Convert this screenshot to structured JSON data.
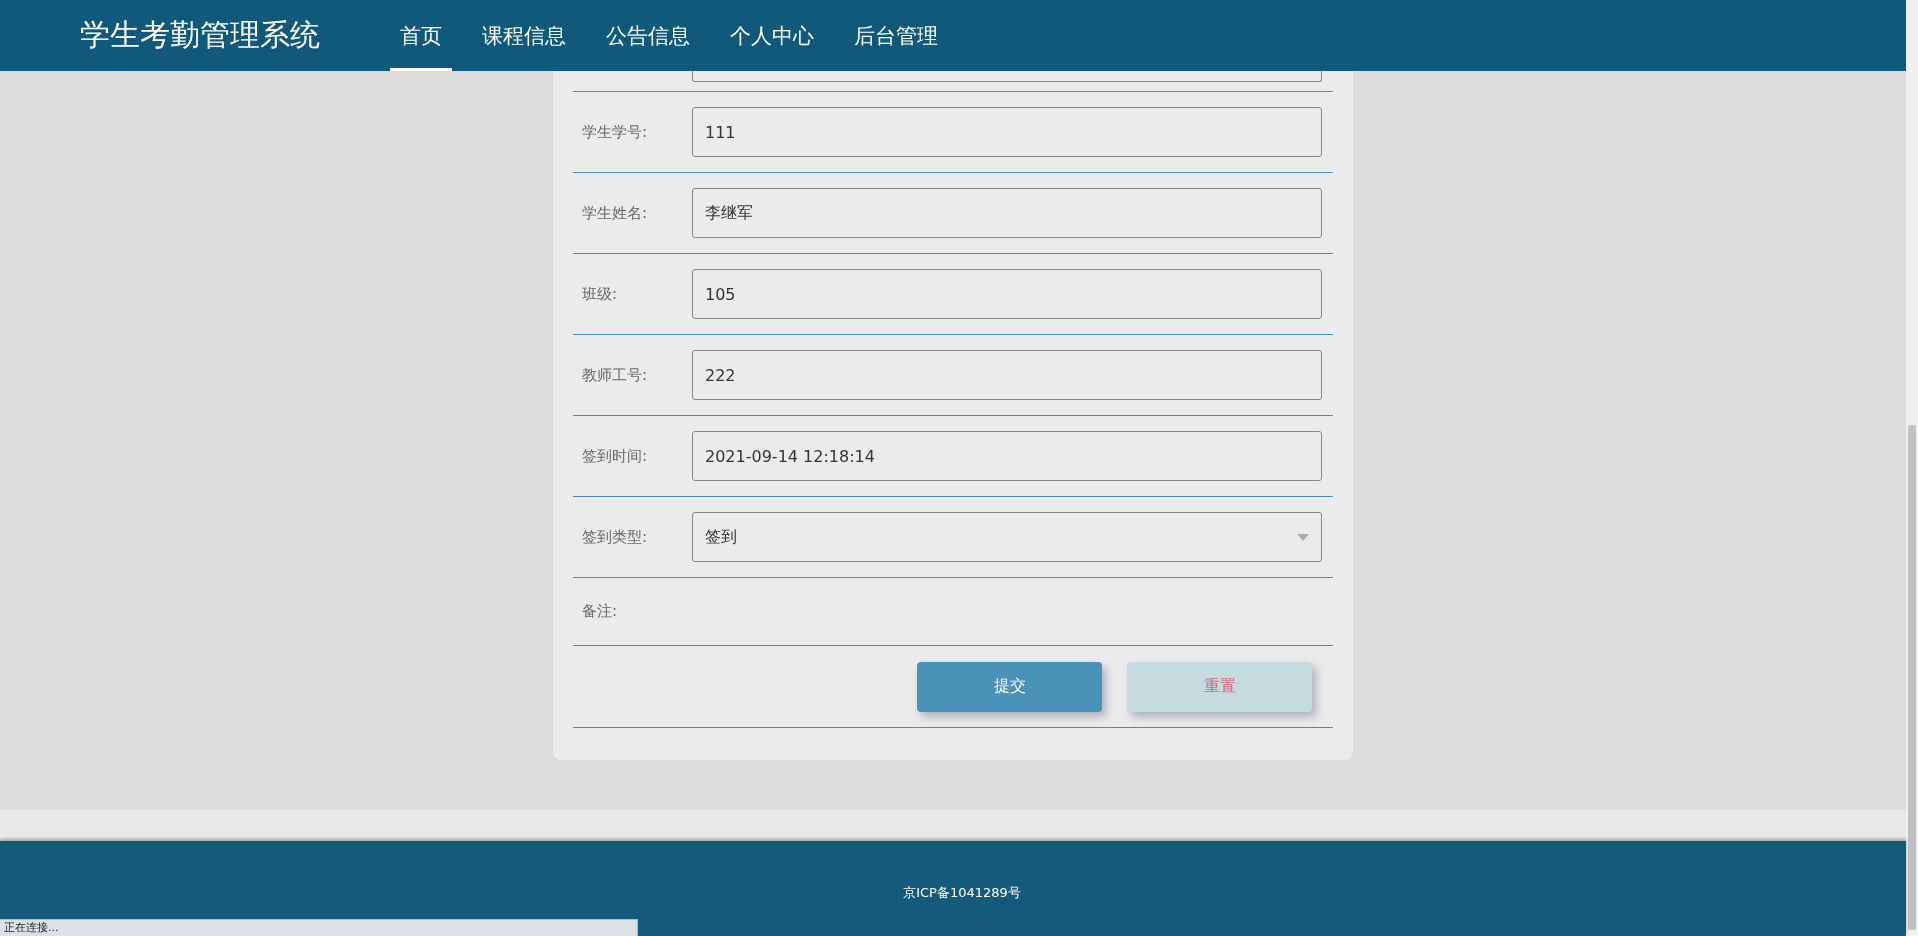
{
  "header": {
    "title": "学生考勤管理系统",
    "nav": [
      {
        "label": "首页",
        "selected": true
      },
      {
        "label": "课程信息",
        "selected": false
      },
      {
        "label": "公告信息",
        "selected": false
      },
      {
        "label": "个人中心",
        "selected": false
      },
      {
        "label": "后台管理",
        "selected": false
      }
    ]
  },
  "form": {
    "rows": [
      {
        "kind": "input",
        "label": "学生学号:",
        "value": "111"
      },
      {
        "kind": "input",
        "label": "学生姓名:",
        "value": "李继军"
      },
      {
        "kind": "input",
        "label": "班级:",
        "value": "105"
      },
      {
        "kind": "input",
        "label": "教师工号:",
        "value": "222"
      },
      {
        "kind": "input",
        "label": "签到时间:",
        "value": "2021-09-14 12:18:14"
      },
      {
        "kind": "select",
        "label": "签到类型:",
        "value": "签到"
      },
      {
        "kind": "note",
        "label": "备注:"
      }
    ],
    "buttons": [
      {
        "kind": "primary",
        "label": "提交"
      },
      {
        "kind": "secondary",
        "label": "重置"
      }
    ]
  },
  "footer": {
    "text": "京ICP备1041289号"
  },
  "status_bar": {
    "text": "正在连接..."
  }
}
